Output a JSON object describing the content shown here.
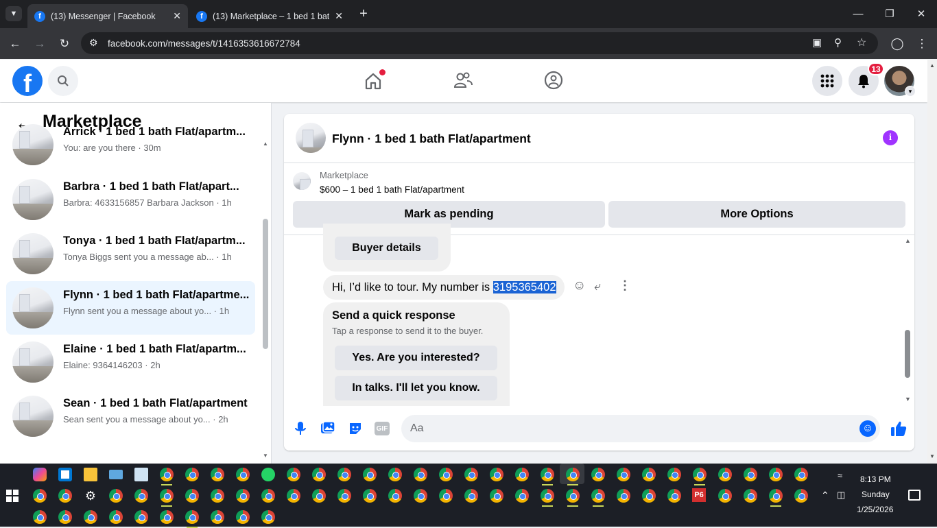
{
  "browser": {
    "tabs": [
      {
        "title": "(13) Messenger | Facebook",
        "icon": "facebook-icon",
        "active": true
      },
      {
        "title": "(13) Marketplace – 1 bed 1 bath",
        "icon": "facebook-icon",
        "active": false
      }
    ],
    "url": "facebook.com/messages/t/1416353616672784"
  },
  "fb_header": {
    "notification_count": "13",
    "accent": "#1877f2"
  },
  "left_panel": {
    "title": "Marketplace",
    "conversations": [
      {
        "name": "Arrick · 1 bed 1 bath Flat/apartm...",
        "preview": "You: are you there · 30m"
      },
      {
        "name": "Barbra · 1 bed 1 bath Flat/apart...",
        "preview": "Barbra: 4633156857 Barbara Jackson · 1h"
      },
      {
        "name": "Tonya · 1 bed 1 bath Flat/apartm...",
        "preview": "Tonya Biggs sent you a message ab... · 1h"
      },
      {
        "name": "Flynn · 1 bed 1 bath Flat/apartme...",
        "preview": "Flynn sent you a message about yo... · 1h",
        "selected": true
      },
      {
        "name": "Elaine · 1 bed 1 bath Flat/apartm...",
        "preview": "Elaine: 9364146203 · 2h"
      },
      {
        "name": "Sean · 1 bed 1 bath Flat/apartment",
        "preview": "Sean sent you a message about yo... · 2h"
      }
    ]
  },
  "chat": {
    "title": "Flynn · 1 bed 1 bath Flat/apartment",
    "listing_label": "Marketplace",
    "listing_price": "$600 – 1 bed 1 bath Flat/apartment",
    "mark_pending": "Mark as pending",
    "more_options": "More Options",
    "buyer_details": "Buyer details",
    "message_prefix": "Hi, I’d like to tour. My number is ",
    "message_number": "3195365402",
    "quick_title": "Send a quick response",
    "quick_sub": "Tap a response to send it to the buyer.",
    "quick_1": "Yes. Are you interested?",
    "quick_2": "In talks. I'll let you know.",
    "composer_placeholder": "Aa"
  },
  "taskbar": {
    "time": "8:13 PM",
    "day": "Sunday",
    "date": "1/25/2026",
    "p6_label": "P6"
  }
}
